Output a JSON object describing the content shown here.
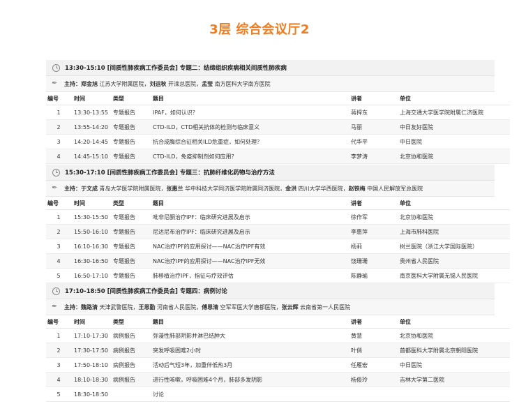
{
  "page": {
    "title": "3层 综合会议厅2"
  },
  "columns": [
    "编号",
    "时间",
    "类型",
    "题目",
    "讲者",
    "单位"
  ],
  "sessions": [
    {
      "header": "13:30-15:10  [间质性肺疾病工作委员会]  专题二：结缔组织疾病相关间质性肺疾病",
      "host_label": "主持：",
      "hosts": [
        {
          "name": "郑金旭",
          "org": "江苏大学附属医院，"
        },
        {
          "name": "刘运秋",
          "org": "开滦总医院，"
        },
        {
          "name": "孟莹",
          "org": "南方医科大学南方医院"
        }
      ],
      "rows": [
        [
          "1",
          "13:30-13:55",
          "专题报告",
          "IPAF，如何认识？",
          "蒋捍东",
          "上海交通大学医学院附属仁济医院"
        ],
        [
          "2",
          "13:55-14:20",
          "专题报告",
          "CTD-ILD，CTD相关抗体的检测与临床意义",
          "马丽",
          "中日友好医院"
        ],
        [
          "3",
          "14:20-14:45",
          "专题报告",
          "抗合成酶综合征相关ILD危重症，如何处理？",
          "代华平",
          "中日医院"
        ],
        [
          "4",
          "14:45-15:10",
          "专题报告",
          "CTD-ILD，免疫抑制剂如何应用？",
          "李梦涛",
          "北京协和医院"
        ]
      ]
    },
    {
      "header": "15:30-17:10  [间质性肺疾病工作委员会]  专题三：抗肺纤维化药物与治疗方法",
      "host_label": "主持：",
      "hosts": [
        {
          "name": "于文成",
          "org": "青岛大学医学院附属医院，"
        },
        {
          "name": "张惠兰",
          "org": "华中科技大学同济医学院附属同济医院，"
        },
        {
          "name": "金洪",
          "org": "四川大学华西医院，"
        },
        {
          "name": "赵铁梅",
          "org": "中国人民解放军总医院"
        }
      ],
      "rows": [
        [
          "1",
          "15:30-15:50",
          "专题报告",
          "吡非尼酮治疗IPF：临床研究进展及启示",
          "徐作军",
          "北京协和医院"
        ],
        [
          "2",
          "15:50-16:10",
          "专题报告",
          "尼达尼布治疗IPF：临床研究进展及启示",
          "李惠萍",
          "上海市肺科医院"
        ],
        [
          "3",
          "16:10-16:30",
          "专题报告",
          "NAC治疗IPF的应用探讨——NAC治疗IPF有效",
          "杨莉",
          "树兰医院（浙江大学国际医院）"
        ],
        [
          "4",
          "16:30-16:50",
          "专题报告",
          "NAC治疗IPF的应用探讨——NAC治疗IPF无效",
          "饶珊珊",
          "贵州省人民医院"
        ],
        [
          "5",
          "16:50-17:10",
          "专题报告",
          "肺移植治疗IPF，指征与疗效评估",
          "陈静瑜",
          "南京医科大学附属无锡人民医院"
        ]
      ]
    },
    {
      "header": "17:10-18:50  [间质性肺疾病工作委员会]  专题四：病例讨论",
      "host_label": "主持：",
      "hosts": [
        {
          "name": "魏路清",
          "org": "天津武警医院，"
        },
        {
          "name": "王恩勤",
          "org": "河南省人民医院，"
        },
        {
          "name": "傅恩清",
          "org": "空军军医大学唐都医院，"
        },
        {
          "name": "张云辉",
          "org": "云南省第一人民医院"
        }
      ],
      "rows": [
        [
          "1",
          "17:10-17:30",
          "病例报告",
          "弥漫性肺部阴影并淋巴结肿大",
          "黄慧",
          "北京协和医院"
        ],
        [
          "2",
          "17:30-17:50",
          "病例报告",
          "突发呼吸困难2小时",
          "叶俏",
          "首都医科大学附属北京朝阳医院"
        ],
        [
          "3",
          "17:50-18:10",
          "病例报告",
          "活动后气短3年，加重伴低热3月",
          "任雁宏",
          "中日医院"
        ],
        [
          "4",
          "18:10-18:30",
          "病例报告",
          "进行性咳嗽，呼吸困难4个月，肺部多发阴影",
          "杨俊玲",
          "吉林大学第二医院"
        ],
        [
          "5",
          "18:30-18:50",
          "",
          "讨论",
          "",
          ""
        ]
      ]
    }
  ]
}
